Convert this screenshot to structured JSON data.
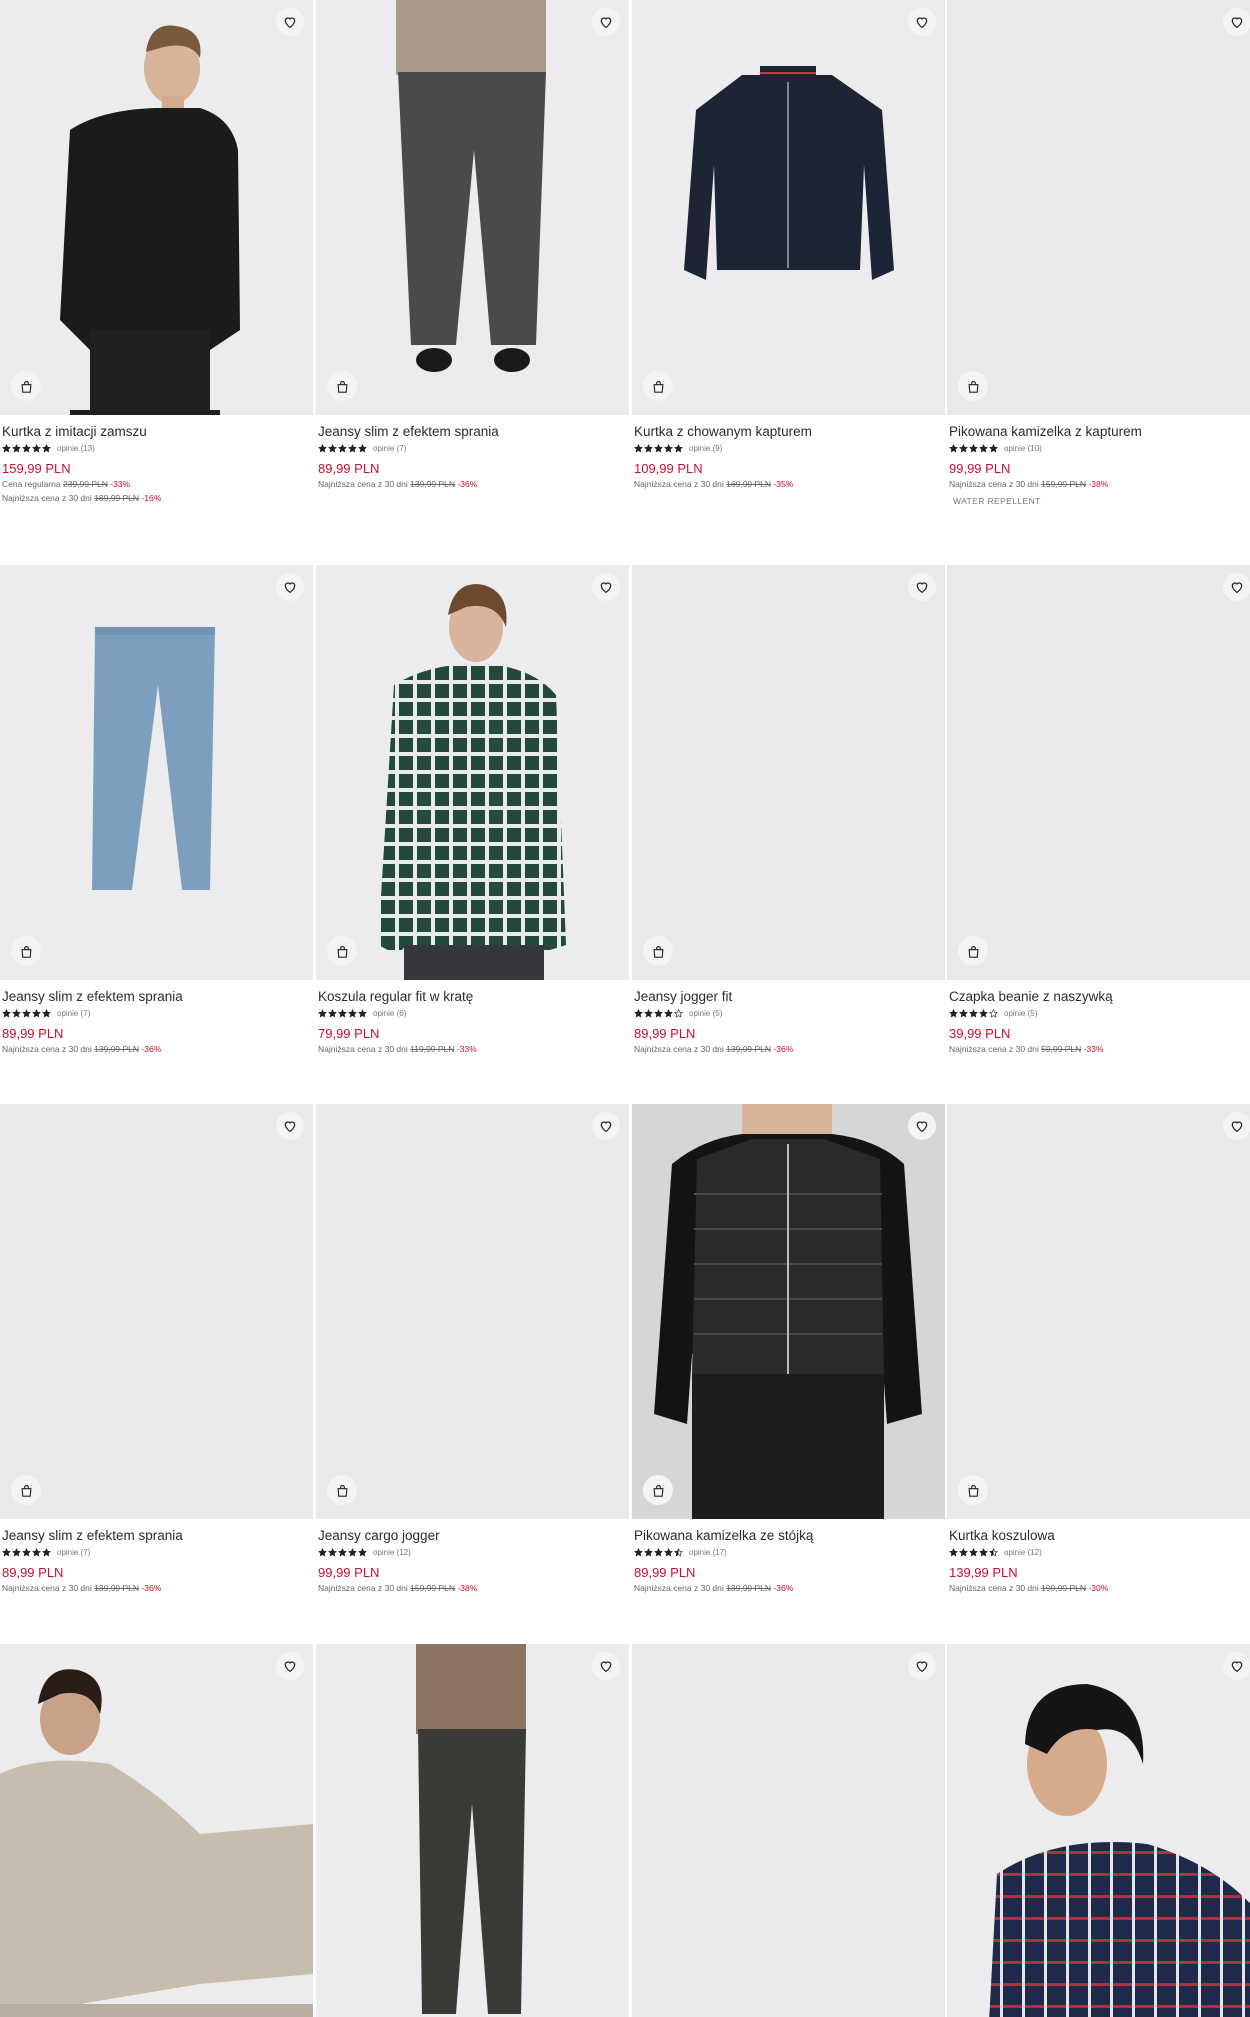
{
  "accent_color": "#c8102e",
  "icons": {
    "favorite": "heart-outline-icon",
    "add_to_bag": "shopping-bag-icon",
    "rating": "star-icon"
  },
  "products": [
    {
      "name": "Kurtka z imitacji zamszu",
      "rating": 5,
      "reviews": "opinie (13)",
      "price": "159,99 PLN",
      "regular_label": "Cena regularna",
      "regular_old": "239,99 PLN",
      "regular_disc": "-33%",
      "lowest_label": "Najniższa cena z 30 dni",
      "lowest_old": "189,99 PLN",
      "lowest_disc": "-16%"
    },
    {
      "name": "Jeansy slim z efektem sprania",
      "rating": 5,
      "reviews": "opinie (7)",
      "price": "89,99 PLN",
      "lowest_label": "Najniższa cena z 30 dni",
      "lowest_old": "139,99 PLN",
      "lowest_disc": "-36%"
    },
    {
      "name": "Kurtka z chowanym kapturem",
      "rating": 5,
      "reviews": "opinie (9)",
      "price": "109,99 PLN",
      "lowest_label": "Najniższa cena z 30 dni",
      "lowest_old": "169,99 PLN",
      "lowest_disc": "-35%"
    },
    {
      "name": "Pikowana kamizelka z kapturem",
      "rating": 5,
      "reviews": "opinie (10)",
      "price": "99,99 PLN",
      "lowest_label": "Najniższa cena z 30 dni",
      "lowest_old": "159,99 PLN",
      "lowest_disc": "-38%",
      "tag": "WATER REPELLENT"
    },
    {
      "name": "Jeansy slim z efektem sprania",
      "rating": 5,
      "reviews": "opinie (7)",
      "price": "89,99 PLN",
      "lowest_label": "Najniższa cena z 30 dni",
      "lowest_old": "139,99 PLN",
      "lowest_disc": "-36%"
    },
    {
      "name": "Koszula regular fit w kratę",
      "rating": 5,
      "reviews": "opinie (6)",
      "price": "79,99 PLN",
      "lowest_label": "Najniższa cena z 30 dni",
      "lowest_old": "119,99 PLN",
      "lowest_disc": "-33%"
    },
    {
      "name": "Jeansy jogger fit",
      "rating": 4,
      "reviews": "opinie (5)",
      "price": "89,99 PLN",
      "lowest_label": "Najniższa cena z 30 dni",
      "lowest_old": "139,99 PLN",
      "lowest_disc": "-36%"
    },
    {
      "name": "Czapka beanie z naszywką",
      "rating": 4,
      "reviews": "opinie (5)",
      "price": "39,99 PLN",
      "lowest_label": "Najniższa cena z 30 dni",
      "lowest_old": "59,99 PLN",
      "lowest_disc": "-33%"
    },
    {
      "name": "Jeansy slim z efektem sprania",
      "rating": 5,
      "reviews": "opinie (7)",
      "price": "89,99 PLN",
      "lowest_label": "Najniższa cena z 30 dni",
      "lowest_old": "139,99 PLN",
      "lowest_disc": "-36%"
    },
    {
      "name": "Jeansy cargo jogger",
      "rating": 5,
      "reviews": "opinie (12)",
      "price": "99,99 PLN",
      "lowest_label": "Najniższa cena z 30 dni",
      "lowest_old": "159,99 PLN",
      "lowest_disc": "-38%"
    },
    {
      "name": "Pikowana kamizelka ze stójką",
      "rating": 4.5,
      "reviews": "opinie (17)",
      "price": "89,99 PLN",
      "lowest_label": "Najniższa cena z 30 dni",
      "lowest_old": "139,99 PLN",
      "lowest_disc": "-36%"
    },
    {
      "name": "Kurtka koszulowa",
      "rating": 4.5,
      "reviews": "opinie (12)",
      "price": "139,99 PLN",
      "lowest_label": "Najniższa cena z 30 dni",
      "lowest_old": "199,99 PLN",
      "lowest_disc": "-30%"
    }
  ]
}
